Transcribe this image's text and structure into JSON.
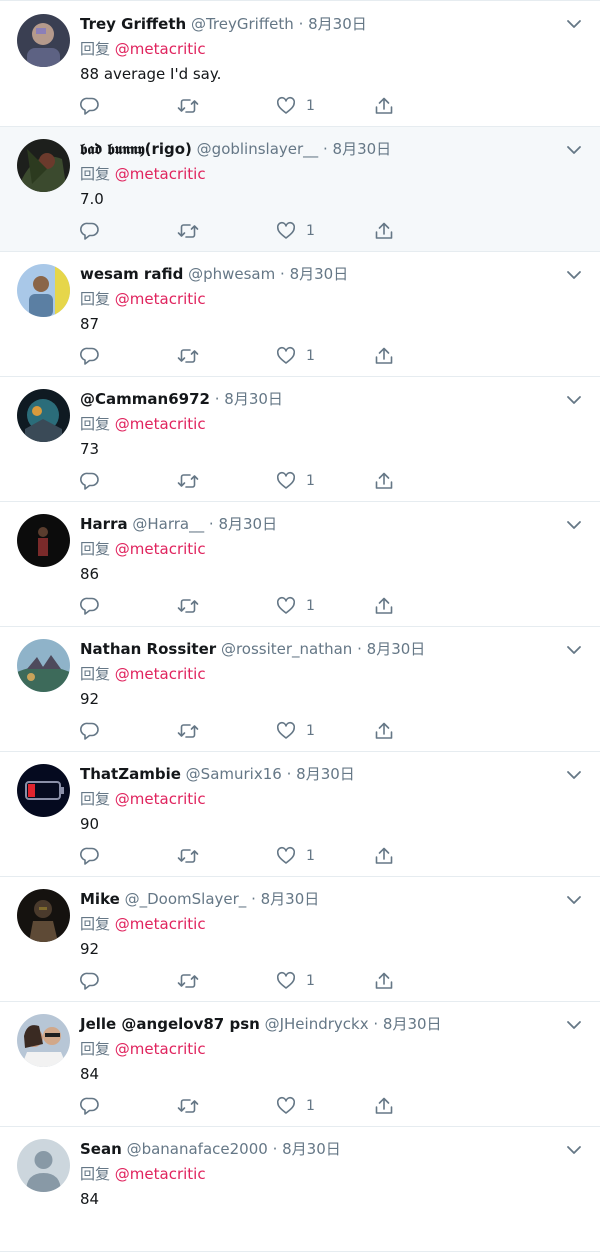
{
  "reply_prefix": "回复",
  "mention": "@metacritic",
  "colors": {
    "name": "#14171a",
    "muted": "#657786",
    "mention": "#e0245e",
    "hover_bg": "#f5f8fa",
    "divider": "#e6ecf0"
  },
  "icons": [
    "reply-icon",
    "retweet-icon",
    "like-icon",
    "share-icon",
    "caret-down-icon"
  ],
  "tweets": [
    {
      "name": "Trey Griffeth",
      "handle": "@TreyGriffeth",
      "date": "8月30日",
      "text": "88 average I'd say.",
      "likes": "1"
    },
    {
      "name": "𝖇𝖆𝖉 𝖇𝖚𝖓𝖓𝖞(rigo)",
      "handle": "@goblinslayer__",
      "date": "8月30日",
      "text": "7.0",
      "likes": "1"
    },
    {
      "name": "wesam rafid",
      "handle": "@phwesam",
      "date": "8月30日",
      "text": "87",
      "likes": "1"
    },
    {
      "name": "",
      "handle": "@Camman6972",
      "date": "8月30日",
      "text": "73",
      "likes": "1"
    },
    {
      "name": "Harra",
      "handle": "@Harra__",
      "date": "8月30日",
      "text": "86",
      "likes": "1"
    },
    {
      "name": "Nathan Rossiter",
      "handle": "@rossiter_nathan",
      "date": "8月30日",
      "text": "92",
      "likes": "1"
    },
    {
      "name": "ThatZambie",
      "handle": "@Samurix16",
      "date": "8月30日",
      "text": "90",
      "likes": "1"
    },
    {
      "name": "Mike",
      "handle": "@_DoomSlayer_",
      "date": "8月30日",
      "text": "92",
      "likes": "1"
    },
    {
      "name": "Jelle @angelov87 psn",
      "handle": "@JHeindryckx",
      "date": "8月30日",
      "text": "84",
      "likes": "1"
    },
    {
      "name": "Sean",
      "handle": "@bananaface2000",
      "date": "8月30日",
      "text": "84",
      "likes": ""
    }
  ]
}
